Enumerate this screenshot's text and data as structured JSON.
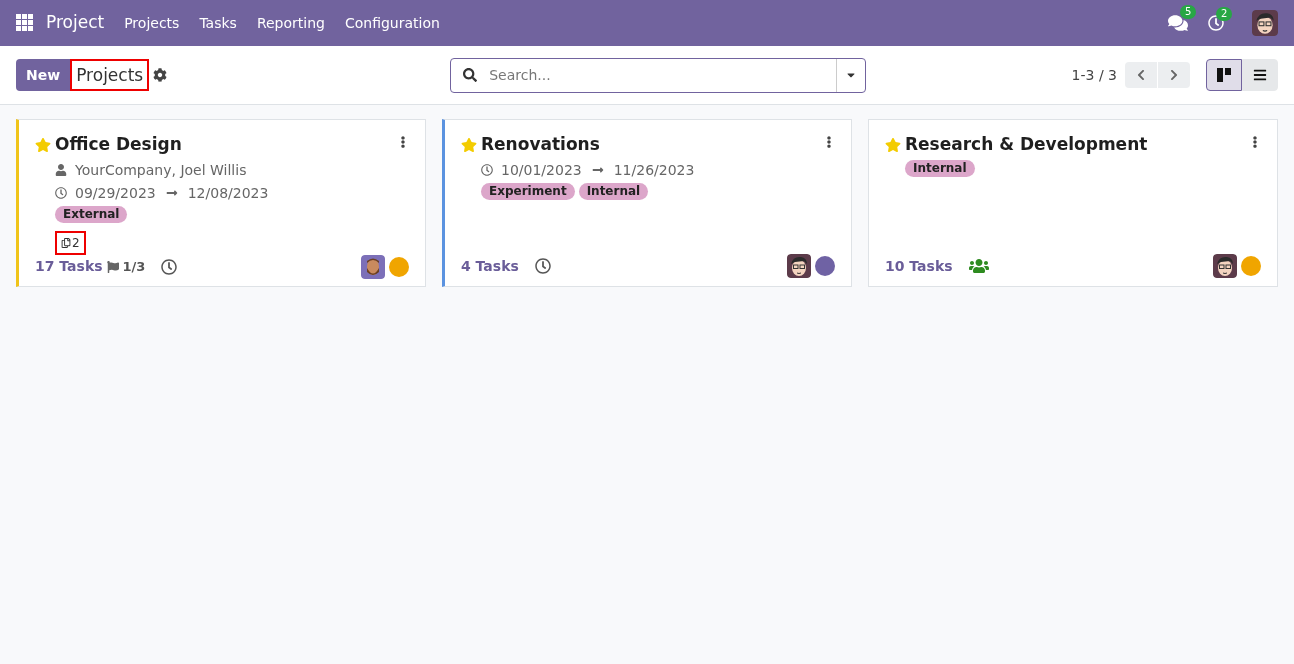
{
  "navbar": {
    "app": "Project",
    "menu": [
      "Projects",
      "Tasks",
      "Reporting",
      "Configuration"
    ],
    "messages_count": "5",
    "activities_count": "2"
  },
  "control_panel": {
    "new_button": "New",
    "breadcrumb": "Projects",
    "breadcrumb_highlighted": true,
    "search": {
      "placeholder": "Search..."
    },
    "pager": "1-3 / 3",
    "views": [
      {
        "kind": "kanban",
        "selected": true
      },
      {
        "kind": "list",
        "selected": false
      }
    ]
  },
  "cards": [
    {
      "title": "Office Design",
      "favorite": true,
      "color": "#f0c419",
      "partner": "YourCompany, Joel Willis",
      "date_start": "09/29/2023",
      "date_end": "12/08/2023",
      "tags": [
        "External"
      ],
      "documents": "2",
      "documents_highlighted": true,
      "tasks": "17 Tasks",
      "milestones": "1/3",
      "activity": {
        "kind": "clock"
      },
      "avatar": {
        "kind": "bearded"
      },
      "status": {
        "color": "#f0a500"
      }
    },
    {
      "title": "Renovations",
      "favorite": true,
      "color": "#5b93e0",
      "date_start": "10/01/2023",
      "date_end": "11/26/2023",
      "tags": [
        "Experiment",
        "Internal"
      ],
      "tasks": "4 Tasks",
      "activity": {
        "kind": "clock"
      },
      "avatar": {
        "kind": "glasses"
      },
      "status": {
        "color": "#6f62a4"
      }
    },
    {
      "title": "Research & Development",
      "favorite": true,
      "tags": [
        "Internal"
      ],
      "tasks": "10 Tasks",
      "activity": {
        "kind": "people"
      },
      "avatar": {
        "kind": "glasses"
      },
      "status": {
        "color": "#f0a500"
      }
    }
  ]
}
